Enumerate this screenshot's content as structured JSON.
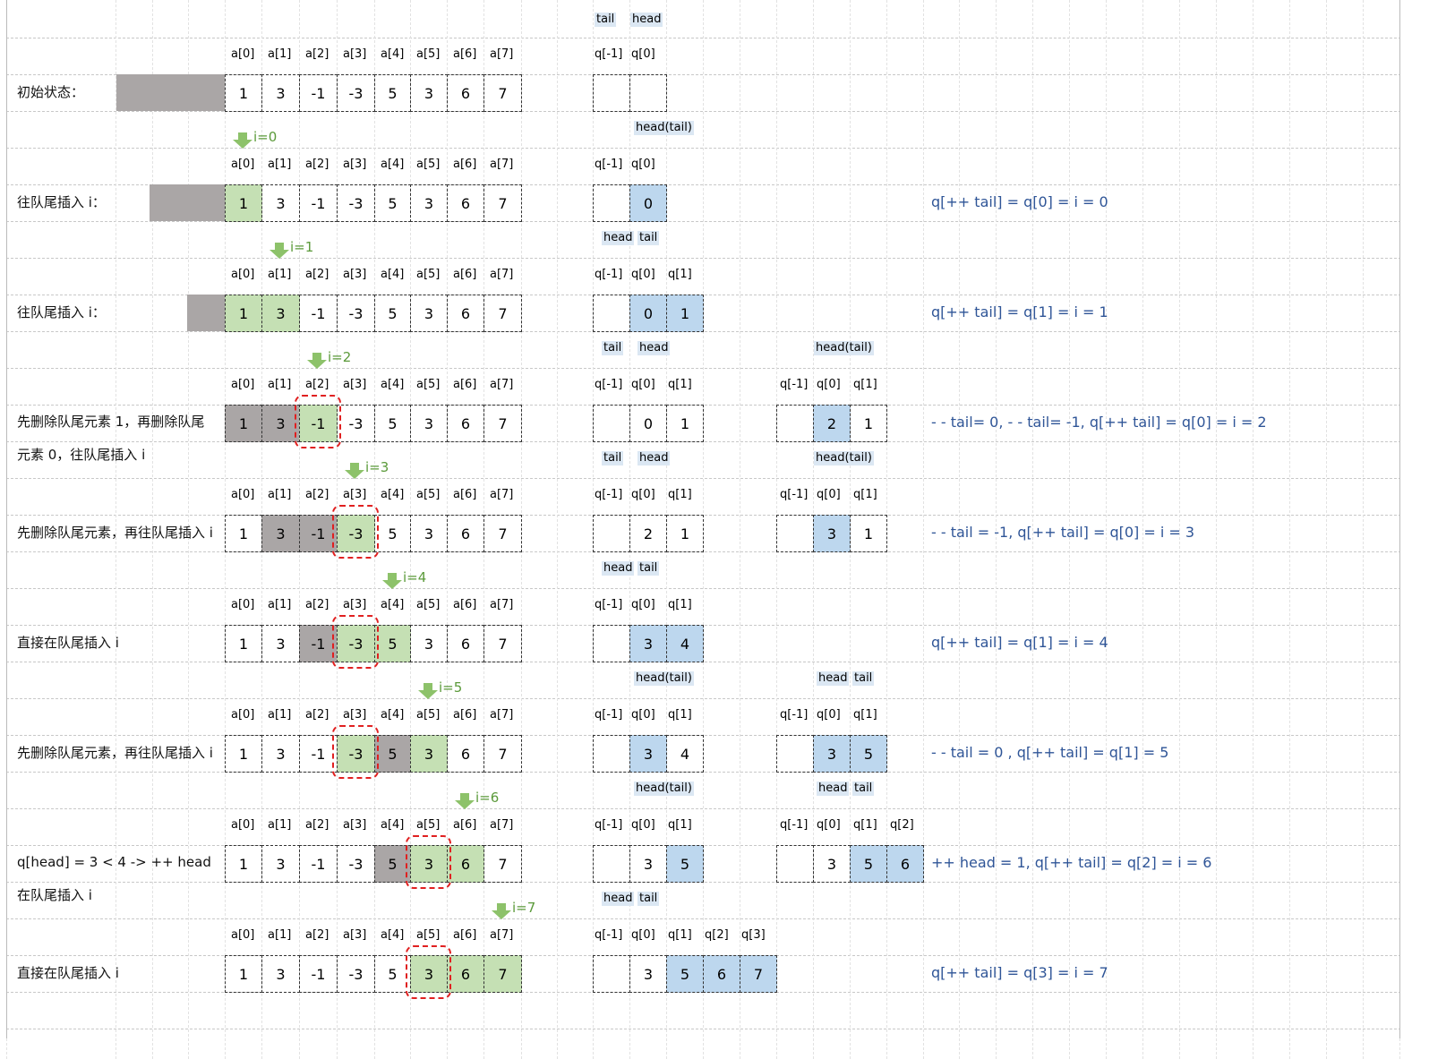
{
  "colors": {
    "green": "#c5e0b4",
    "gray": "#aaa6a6",
    "blue": "#bdd7ee",
    "note": "#2f5597",
    "arrow": "#8dc26a",
    "highlight": "#e02020"
  },
  "top_labels": {
    "tail": "tail",
    "head": "head"
  },
  "a_headers": [
    "a[0]",
    "a[1]",
    "a[2]",
    "a[3]",
    "a[4]",
    "a[5]",
    "a[6]",
    "a[7]"
  ],
  "rows": [
    {
      "label": "初始状态：",
      "label2": "",
      "a": [
        "1",
        "3",
        "-1",
        "-3",
        "5",
        "3",
        "6",
        "7"
      ],
      "a_color": [
        0,
        0,
        0,
        0,
        0,
        0,
        0,
        0
      ],
      "arrow": "",
      "q1_headers": [
        "q[-1]",
        "q[0]"
      ],
      "q1": [
        "",
        ""
      ],
      "q1_color": [
        0,
        0
      ],
      "q1_ptrs": [
        "head(tail)"
      ],
      "q2_headers": [],
      "q2": [],
      "q2_color": [],
      "q2_ptrs": [],
      "note": ""
    },
    {
      "label": "往队尾插入 i：",
      "label2": "",
      "a": [
        "1",
        "3",
        "-1",
        "-3",
        "5",
        "3",
        "6",
        "7"
      ],
      "a_color": [
        1,
        0,
        0,
        0,
        0,
        0,
        0,
        0
      ],
      "arrow": "i=0",
      "q1_headers": [
        "q[-1]",
        "q[0]"
      ],
      "q1": [
        "",
        "0"
      ],
      "q1_color": [
        0,
        3
      ],
      "q1_ptrs": [
        "head",
        "tail"
      ],
      "q2_headers": [],
      "q2": [],
      "q2_color": [],
      "q2_ptrs": [],
      "note": "q[++ tail] = q[0] = i = 0"
    },
    {
      "label": "往队尾插入 i：",
      "label2": "",
      "a": [
        "1",
        "3",
        "-1",
        "-3",
        "5",
        "3",
        "6",
        "7"
      ],
      "a_color": [
        1,
        1,
        0,
        0,
        0,
        0,
        0,
        0
      ],
      "arrow": "i=1",
      "q1_headers": [
        "q[-1]",
        "q[0]",
        "q[1]"
      ],
      "q1": [
        "",
        "0",
        "1"
      ],
      "q1_color": [
        0,
        3,
        3
      ],
      "q1_ptrs": [
        "tail",
        "head"
      ],
      "q2_headers": [],
      "q2": [],
      "q2_color": [],
      "q2_ptrs": [
        "head(tail)"
      ],
      "note": "q[++ tail] = q[1] = i = 1"
    },
    {
      "label": "先删除队尾元素 1，再删除队尾",
      "label2": "元素 0，往队尾插入 i",
      "a": [
        "1",
        "3",
        "-1",
        "-3",
        "5",
        "3",
        "6",
        "7"
      ],
      "a_color": [
        2,
        2,
        1,
        0,
        0,
        0,
        0,
        0
      ],
      "arrow": "i=2",
      "q1_headers": [
        "q[-1]",
        "q[0]",
        "q[1]"
      ],
      "q1": [
        "",
        "0",
        "1"
      ],
      "q1_color": [
        0,
        0,
        0
      ],
      "q1_ptrs": [
        "tail",
        "head"
      ],
      "q2_headers": [
        "q[-1]",
        "q[0]",
        "q[1]"
      ],
      "q2": [
        "",
        "2",
        "1"
      ],
      "q2_color": [
        0,
        3,
        0
      ],
      "q2_ptrs": [
        "head(tail)"
      ],
      "note": "- - tail= 0,    - - tail= -1,    q[++ tail] = q[0] = i = 2"
    },
    {
      "label": "先删除队尾元素，再往队尾插入 i",
      "label2": "",
      "a": [
        "1",
        "3",
        "-1",
        "-3",
        "5",
        "3",
        "6",
        "7"
      ],
      "a_color": [
        0,
        2,
        2,
        1,
        0,
        0,
        0,
        0
      ],
      "arrow": "i=3",
      "q1_headers": [
        "q[-1]",
        "q[0]",
        "q[1]"
      ],
      "q1": [
        "",
        "2",
        "1"
      ],
      "q1_color": [
        0,
        0,
        0
      ],
      "q1_ptrs": [
        "head",
        "tail"
      ],
      "q2_headers": [
        "q[-1]",
        "q[0]",
        "q[1]"
      ],
      "q2": [
        "",
        "3",
        "1"
      ],
      "q2_color": [
        0,
        3,
        0
      ],
      "q2_ptrs": [],
      "note": "- - tail = -1,    q[++ tail] = q[0] = i = 3"
    },
    {
      "label": "直接在队尾插入 i",
      "label2": "",
      "a": [
        "1",
        "3",
        "-1",
        "-3",
        "5",
        "3",
        "6",
        "7"
      ],
      "a_color": [
        0,
        0,
        2,
        1,
        1,
        0,
        0,
        0
      ],
      "arrow": "i=4",
      "q1_headers": [
        "q[-1]",
        "q[0]",
        "q[1]"
      ],
      "q1": [
        "",
        "3",
        "4"
      ],
      "q1_color": [
        0,
        3,
        3
      ],
      "q1_ptrs": [
        "head(tail)"
      ],
      "q2_headers": [],
      "q2": [],
      "q2_color": [],
      "q2_ptrs": [
        "head",
        "tail"
      ],
      "note": "q[++ tail] = q[1] = i = 4"
    },
    {
      "label": "先删除队尾元素，再往队尾插入 i",
      "label2": "",
      "a": [
        "1",
        "3",
        "-1",
        "-3",
        "5",
        "3",
        "6",
        "7"
      ],
      "a_color": [
        0,
        0,
        0,
        1,
        2,
        1,
        0,
        0
      ],
      "arrow": "i=5",
      "q1_headers": [
        "q[-1]",
        "q[0]",
        "q[1]"
      ],
      "q1": [
        "",
        "3",
        "4"
      ],
      "q1_color": [
        0,
        3,
        0
      ],
      "q1_ptrs": [
        "head(tail)"
      ],
      "q2_headers": [
        "q[-1]",
        "q[0]",
        "q[1]"
      ],
      "q2": [
        "",
        "3",
        "5"
      ],
      "q2_color": [
        0,
        3,
        3
      ],
      "q2_ptrs": [
        "head",
        "tail"
      ],
      "note": "- - tail = 0 ,     q[++ tail] = q[1] = 5"
    },
    {
      "label": "q[head] = 3 < 4 -> ++ head",
      "label2": "在队尾插入 i",
      "a": [
        "1",
        "3",
        "-1",
        "-3",
        "5",
        "3",
        "6",
        "7"
      ],
      "a_color": [
        0,
        0,
        0,
        0,
        2,
        1,
        1,
        0
      ],
      "arrow": "i=6",
      "q1_headers": [
        "q[-1]",
        "q[0]",
        "q[1]"
      ],
      "q1": [
        "",
        "3",
        "5"
      ],
      "q1_color": [
        0,
        0,
        3
      ],
      "q1_ptrs": [
        "head",
        "tail"
      ],
      "q2_headers": [
        "q[-1]",
        "q[0]",
        "q[1]",
        "q[2]"
      ],
      "q2": [
        "",
        "3",
        "5",
        "6"
      ],
      "q2_color": [
        0,
        0,
        3,
        3
      ],
      "q2_ptrs": [],
      "note": "++ head = 1,    q[++ tail] = q[2] = i = 6"
    },
    {
      "label": "直接在队尾插入 i",
      "label2": "",
      "a": [
        "1",
        "3",
        "-1",
        "-3",
        "5",
        "3",
        "6",
        "7"
      ],
      "a_color": [
        0,
        0,
        0,
        0,
        0,
        1,
        1,
        1
      ],
      "arrow": "i=7",
      "q1_headers": [
        "q[-1]",
        "q[0]",
        "q[1]",
        "q[2]",
        "q[3]"
      ],
      "q1": [
        "",
        "3",
        "5",
        "6",
        "7"
      ],
      "q1_color": [
        0,
        0,
        3,
        3,
        3
      ],
      "q1_ptrs": [],
      "q2_headers": [],
      "q2": [],
      "q2_color": [],
      "q2_ptrs": [],
      "note": "q[++ tail] = q[3] = i = 7"
    }
  ]
}
